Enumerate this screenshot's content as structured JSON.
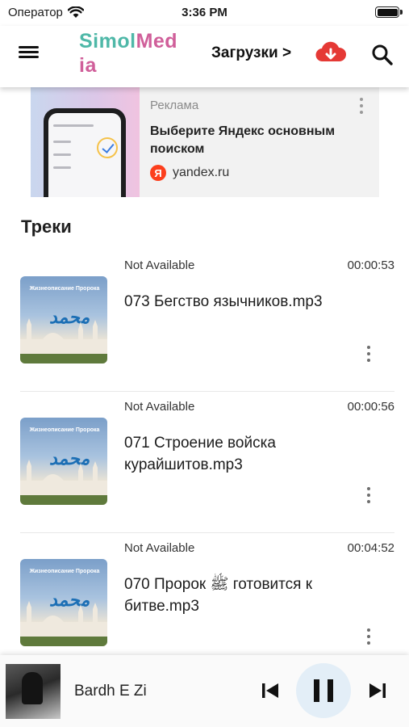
{
  "status_bar": {
    "carrier": "Оператор",
    "time": "3:36 PM"
  },
  "header": {
    "logo_part1": "SimolMed",
    "logo_part1_accent": "Med",
    "logo_part2": "ia",
    "downloads_label": "Загрузки >",
    "icons": [
      "menu-icon",
      "cloud-download-icon",
      "search-icon"
    ]
  },
  "ad": {
    "label": "Реклама",
    "title": "Выберите Яндекс основным поиском",
    "source_icon": "Я",
    "source": "yandex.ru"
  },
  "tracks_section": {
    "title": "Треки",
    "items": [
      {
        "status": "Not Available",
        "duration": "00:00:53",
        "name": "073 Бегство язычников.mp3"
      },
      {
        "status": "Not Available",
        "duration": "00:00:56",
        "name": "071 Строение войска курайшитов.mp3"
      },
      {
        "status": "Not Available",
        "duration": "00:04:52",
        "name": "070 Пророк ﷺ готовится к битве.mp3"
      }
    ]
  },
  "player": {
    "title": "Bardh E Zi",
    "state": "playing"
  },
  "colors": {
    "logo_teal": "#4fb8a8",
    "logo_pink": "#d05f9a",
    "download_red": "#e53935",
    "play_button_bg": "#e3eef7",
    "yandex_red": "#fc3f1d"
  }
}
